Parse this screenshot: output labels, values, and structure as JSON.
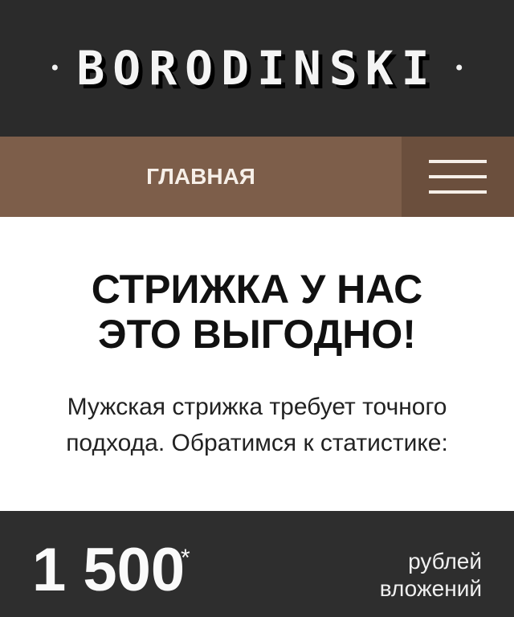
{
  "header": {
    "logo_text": "BORODINSKI",
    "logo_dot_left": "•",
    "logo_dot_right": "•"
  },
  "nav": {
    "main_label": "ГЛАВНАЯ",
    "menu_icon": "hamburger-menu-icon"
  },
  "intro": {
    "title_line1": "СТРИЖКА У НАС",
    "title_line2": "ЭТО ВЫГОДНО!",
    "desc_line1": "Мужская стрижка требует точного",
    "desc_line2": "подхода. Обратимся к статистике:"
  },
  "stats": {
    "value": "1 500",
    "asterisk": "*",
    "label_line1": "рублей",
    "label_line2": "вложений"
  },
  "colors": {
    "header_bg": "#2b2b2b",
    "nav_bg": "#7d5e4a",
    "nav_menu_bg": "#6b4f3d",
    "stats_bg": "#2e2e2e"
  }
}
